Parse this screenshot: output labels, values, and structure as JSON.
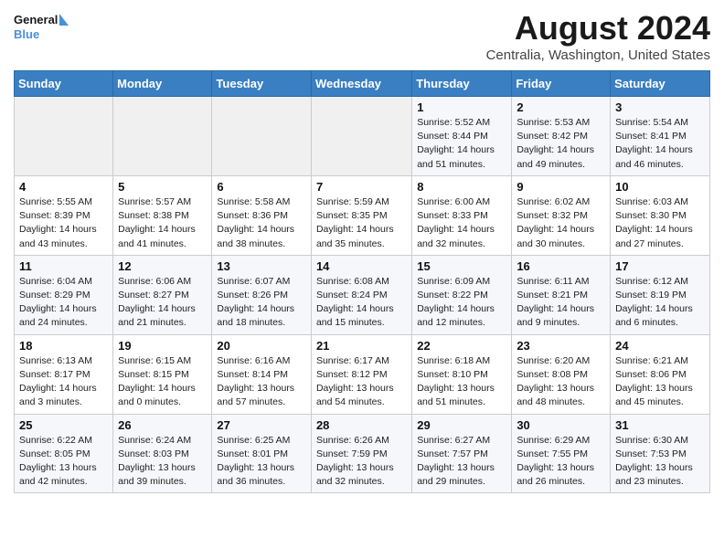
{
  "header": {
    "logo_line1": "General",
    "logo_line2": "Blue",
    "main_title": "August 2024",
    "subtitle": "Centralia, Washington, United States"
  },
  "days_of_week": [
    "Sunday",
    "Monday",
    "Tuesday",
    "Wednesday",
    "Thursday",
    "Friday",
    "Saturday"
  ],
  "weeks": [
    [
      {
        "day": "",
        "sunrise": "",
        "sunset": "",
        "daylight": ""
      },
      {
        "day": "",
        "sunrise": "",
        "sunset": "",
        "daylight": ""
      },
      {
        "day": "",
        "sunrise": "",
        "sunset": "",
        "daylight": ""
      },
      {
        "day": "",
        "sunrise": "",
        "sunset": "",
        "daylight": ""
      },
      {
        "day": "1",
        "sunrise": "Sunrise: 5:52 AM",
        "sunset": "Sunset: 8:44 PM",
        "daylight": "Daylight: 14 hours and 51 minutes."
      },
      {
        "day": "2",
        "sunrise": "Sunrise: 5:53 AM",
        "sunset": "Sunset: 8:42 PM",
        "daylight": "Daylight: 14 hours and 49 minutes."
      },
      {
        "day": "3",
        "sunrise": "Sunrise: 5:54 AM",
        "sunset": "Sunset: 8:41 PM",
        "daylight": "Daylight: 14 hours and 46 minutes."
      }
    ],
    [
      {
        "day": "4",
        "sunrise": "Sunrise: 5:55 AM",
        "sunset": "Sunset: 8:39 PM",
        "daylight": "Daylight: 14 hours and 43 minutes."
      },
      {
        "day": "5",
        "sunrise": "Sunrise: 5:57 AM",
        "sunset": "Sunset: 8:38 PM",
        "daylight": "Daylight: 14 hours and 41 minutes."
      },
      {
        "day": "6",
        "sunrise": "Sunrise: 5:58 AM",
        "sunset": "Sunset: 8:36 PM",
        "daylight": "Daylight: 14 hours and 38 minutes."
      },
      {
        "day": "7",
        "sunrise": "Sunrise: 5:59 AM",
        "sunset": "Sunset: 8:35 PM",
        "daylight": "Daylight: 14 hours and 35 minutes."
      },
      {
        "day": "8",
        "sunrise": "Sunrise: 6:00 AM",
        "sunset": "Sunset: 8:33 PM",
        "daylight": "Daylight: 14 hours and 32 minutes."
      },
      {
        "day": "9",
        "sunrise": "Sunrise: 6:02 AM",
        "sunset": "Sunset: 8:32 PM",
        "daylight": "Daylight: 14 hours and 30 minutes."
      },
      {
        "day": "10",
        "sunrise": "Sunrise: 6:03 AM",
        "sunset": "Sunset: 8:30 PM",
        "daylight": "Daylight: 14 hours and 27 minutes."
      }
    ],
    [
      {
        "day": "11",
        "sunrise": "Sunrise: 6:04 AM",
        "sunset": "Sunset: 8:29 PM",
        "daylight": "Daylight: 14 hours and 24 minutes."
      },
      {
        "day": "12",
        "sunrise": "Sunrise: 6:06 AM",
        "sunset": "Sunset: 8:27 PM",
        "daylight": "Daylight: 14 hours and 21 minutes."
      },
      {
        "day": "13",
        "sunrise": "Sunrise: 6:07 AM",
        "sunset": "Sunset: 8:26 PM",
        "daylight": "Daylight: 14 hours and 18 minutes."
      },
      {
        "day": "14",
        "sunrise": "Sunrise: 6:08 AM",
        "sunset": "Sunset: 8:24 PM",
        "daylight": "Daylight: 14 hours and 15 minutes."
      },
      {
        "day": "15",
        "sunrise": "Sunrise: 6:09 AM",
        "sunset": "Sunset: 8:22 PM",
        "daylight": "Daylight: 14 hours and 12 minutes."
      },
      {
        "day": "16",
        "sunrise": "Sunrise: 6:11 AM",
        "sunset": "Sunset: 8:21 PM",
        "daylight": "Daylight: 14 hours and 9 minutes."
      },
      {
        "day": "17",
        "sunrise": "Sunrise: 6:12 AM",
        "sunset": "Sunset: 8:19 PM",
        "daylight": "Daylight: 14 hours and 6 minutes."
      }
    ],
    [
      {
        "day": "18",
        "sunrise": "Sunrise: 6:13 AM",
        "sunset": "Sunset: 8:17 PM",
        "daylight": "Daylight: 14 hours and 3 minutes."
      },
      {
        "day": "19",
        "sunrise": "Sunrise: 6:15 AM",
        "sunset": "Sunset: 8:15 PM",
        "daylight": "Daylight: 14 hours and 0 minutes."
      },
      {
        "day": "20",
        "sunrise": "Sunrise: 6:16 AM",
        "sunset": "Sunset: 8:14 PM",
        "daylight": "Daylight: 13 hours and 57 minutes."
      },
      {
        "day": "21",
        "sunrise": "Sunrise: 6:17 AM",
        "sunset": "Sunset: 8:12 PM",
        "daylight": "Daylight: 13 hours and 54 minutes."
      },
      {
        "day": "22",
        "sunrise": "Sunrise: 6:18 AM",
        "sunset": "Sunset: 8:10 PM",
        "daylight": "Daylight: 13 hours and 51 minutes."
      },
      {
        "day": "23",
        "sunrise": "Sunrise: 6:20 AM",
        "sunset": "Sunset: 8:08 PM",
        "daylight": "Daylight: 13 hours and 48 minutes."
      },
      {
        "day": "24",
        "sunrise": "Sunrise: 6:21 AM",
        "sunset": "Sunset: 8:06 PM",
        "daylight": "Daylight: 13 hours and 45 minutes."
      }
    ],
    [
      {
        "day": "25",
        "sunrise": "Sunrise: 6:22 AM",
        "sunset": "Sunset: 8:05 PM",
        "daylight": "Daylight: 13 hours and 42 minutes."
      },
      {
        "day": "26",
        "sunrise": "Sunrise: 6:24 AM",
        "sunset": "Sunset: 8:03 PM",
        "daylight": "Daylight: 13 hours and 39 minutes."
      },
      {
        "day": "27",
        "sunrise": "Sunrise: 6:25 AM",
        "sunset": "Sunset: 8:01 PM",
        "daylight": "Daylight: 13 hours and 36 minutes."
      },
      {
        "day": "28",
        "sunrise": "Sunrise: 6:26 AM",
        "sunset": "Sunset: 7:59 PM",
        "daylight": "Daylight: 13 hours and 32 minutes."
      },
      {
        "day": "29",
        "sunrise": "Sunrise: 6:27 AM",
        "sunset": "Sunset: 7:57 PM",
        "daylight": "Daylight: 13 hours and 29 minutes."
      },
      {
        "day": "30",
        "sunrise": "Sunrise: 6:29 AM",
        "sunset": "Sunset: 7:55 PM",
        "daylight": "Daylight: 13 hours and 26 minutes."
      },
      {
        "day": "31",
        "sunrise": "Sunrise: 6:30 AM",
        "sunset": "Sunset: 7:53 PM",
        "daylight": "Daylight: 13 hours and 23 minutes."
      }
    ]
  ]
}
